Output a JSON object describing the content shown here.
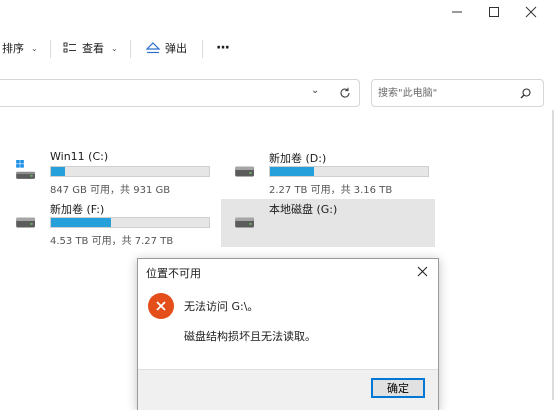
{
  "window": {
    "controls": [
      "minimize",
      "maximize",
      "close"
    ]
  },
  "toolbar": {
    "sort_label": "排序",
    "view_label": "查看",
    "eject_label": "弹出",
    "more_label": "···"
  },
  "address": {
    "value": ""
  },
  "search": {
    "placeholder": "搜索\"此电脑\""
  },
  "drives": [
    {
      "name": "Win11 (C:)",
      "space": "847 GB 可用，共 931 GB",
      "used_fraction": 0.09,
      "icon": "windows-drive-icon"
    },
    {
      "name": "新加卷 (D:)",
      "space": "2.27 TB 可用，共 3.16 TB",
      "used_fraction": 0.28,
      "icon": "hard-drive-icon"
    },
    {
      "name": "新加卷 (F:)",
      "space": "4.53 TB 可用，共 7.27 TB",
      "used_fraction": 0.38,
      "icon": "hard-drive-icon"
    },
    {
      "name": "本地磁盘 (G:)",
      "space": "",
      "used_fraction": null,
      "icon": "hard-drive-icon",
      "selected": true
    }
  ],
  "dialog": {
    "title": "位置不可用",
    "message_line1": "无法访问 G:\\。",
    "message_line2": "磁盘结构损坏且无法读取。",
    "ok_label": "确定"
  },
  "colors": {
    "accent": "#0078d7",
    "bar_fill": "#26a0da",
    "error": "#e34e1b"
  }
}
